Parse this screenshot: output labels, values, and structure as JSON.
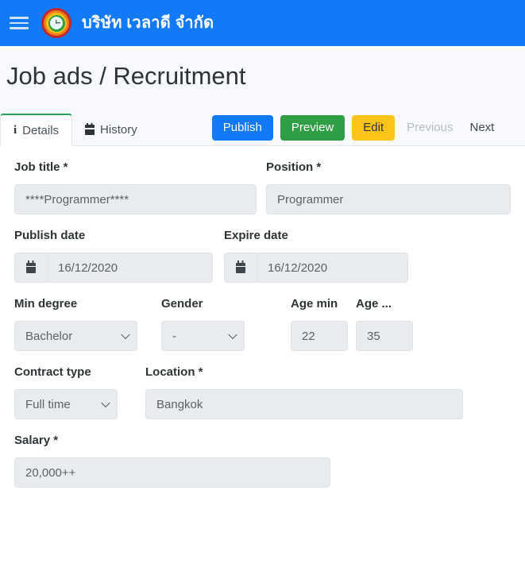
{
  "appbar": {
    "menu_icon": "hamburger-icon",
    "logo_icon": "clock-logo-icon",
    "brand": "บริษัท เวลาดี จำกัด",
    "brand_color": "#ffffff",
    "background_color": "#1279f7"
  },
  "page": {
    "title": "Job ads / Recruitment",
    "background_color": "#f7f9fc"
  },
  "tabs": [
    {
      "label": "Details",
      "icon": "info-icon",
      "active": true
    },
    {
      "label": "History",
      "icon": "calendar-icon",
      "active": false
    }
  ],
  "actions": {
    "publish": {
      "label": "Publish",
      "color": "#1279f7"
    },
    "preview": {
      "label": "Preview",
      "color": "#2f9e44"
    },
    "edit": {
      "label": "Edit",
      "color": "#fcc419"
    },
    "previous": {
      "label": "Previous",
      "disabled": true
    },
    "next": {
      "label": "Next",
      "disabled": false
    }
  },
  "form": {
    "job_title": {
      "label": "Job title *",
      "value": "****Programmer****"
    },
    "position": {
      "label": "Position *",
      "value": "Programmer"
    },
    "publish_date": {
      "label": "Publish date",
      "value": "16/12/2020",
      "icon": "calendar-icon"
    },
    "expire_date": {
      "label": "Expire date",
      "value": "16/12/2020",
      "icon": "calendar-icon"
    },
    "min_degree": {
      "label": "Min degree",
      "value": "Bachelor"
    },
    "gender": {
      "label": "Gender",
      "value": "-"
    },
    "age_min": {
      "label": "Age min",
      "value": "22"
    },
    "age_max": {
      "label": "Age ...",
      "value": "35"
    },
    "contract_type": {
      "label": "Contract type",
      "value": "Full time"
    },
    "location": {
      "label": "Location *",
      "value": "Bangkok"
    },
    "salary": {
      "label": "Salary *",
      "value": "20,000++"
    }
  }
}
